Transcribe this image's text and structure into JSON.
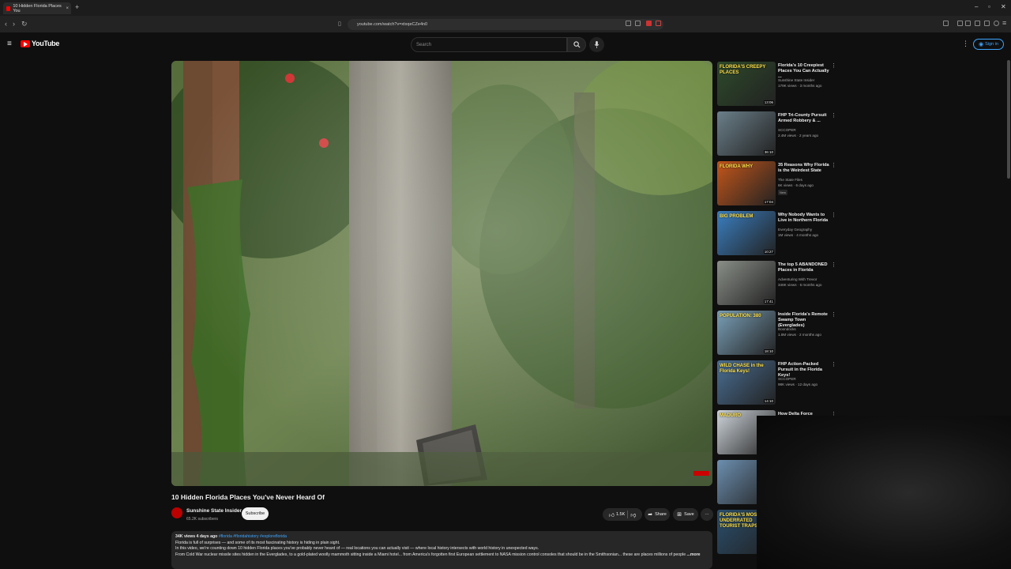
{
  "browser": {
    "tab_title": "10 Hidden Florida Places You",
    "url": "youtube.com/watch?v=xtxqeCZe4n0",
    "new_tab": "+",
    "close_tab": "×"
  },
  "header": {
    "logo_text": "YouTube",
    "search_placeholder": "Search",
    "signin_label": "Sign in"
  },
  "video": {
    "title": "10 Hidden Florida Places You've Never Heard Of",
    "channel": "Sunshine State Insider",
    "subscribers": "65.2K subscribers",
    "subscribe_label": "Subscribe",
    "likes": "1.5K",
    "share_label": "Share",
    "save_label": "Save",
    "more_label": "···"
  },
  "description": {
    "meta": "34K views  4 days ago",
    "hashtags": "#florida #floridahistory #exploreflorida",
    "line1": "Florida is full of surprises — and some of its most fascinating history is hiding in plain sight.",
    "line2": "In this video, we're counting down 10 hidden Florida places you've probably never heard of — real locations you can actually visit — where local history intersects with world history in unexpected ways.",
    "line3": "From Cold War nuclear missile sites hidden in the Everglades, to a gold-plated woolly mammoth sitting inside a Miami hotel... from America's forgotten first European settlement to NASA mission control consoles that should be in the Smithsonian... these are places millions of people",
    "more": "...more"
  },
  "recommendations": [
    {
      "title": "Florida's 10 Creepiest Places You Can Actually ...",
      "channel": "Sunshine State Insider",
      "meta": "179K views · 3 months ago",
      "duration": "13:06",
      "thumb_text": "FLORIDA'S CREEPY PLACES",
      "thumb_color": "#2d4a2a"
    },
    {
      "title": "FHP Tri-County Pursuit Armed Robbery & ...",
      "channel": "SCCOPER",
      "meta": "2.4M views · 2 years ago",
      "duration": "36:10",
      "thumb_text": "",
      "thumb_color": "#6b7f8a"
    },
    {
      "title": "35 Reasons Why Florida is the Weirdest State",
      "channel": "The State Files",
      "meta": "6K views · 6 days ago",
      "duration": "17:04",
      "badge": "New",
      "thumb_text": "FLORIDA WHY",
      "thumb_color": "#c4561a"
    },
    {
      "title": "Why Nobody Wants to Live in Northern Florida",
      "channel": "Everyday Geography",
      "meta": "1M views · 4 months ago",
      "duration": "10:27",
      "thumb_text": "BIG PROBLEM",
      "thumb_color": "#3a7fc1"
    },
    {
      "title": "The top 5 ABANDONED Places in Florida",
      "channel": "Adventuring With Trevor",
      "meta": "348K views · 6 months ago",
      "duration": "17:41",
      "thumb_text": "",
      "thumb_color": "#8a8f88"
    },
    {
      "title": "Inside Florida's Remote Swamp Town (Everglades)",
      "channel": "Boondocks",
      "meta": "1.8M views · 2 months ago",
      "duration": "18:10",
      "thumb_text": "POPULATION: 380",
      "thumb_color": "#7aa0b8"
    },
    {
      "title": "FHP Action-Packed Pursuit in the Florida Keys!",
      "channel": "SCCOPER",
      "meta": "98K views · 12 days ago",
      "duration": "14:10",
      "thumb_text": "WILD CHASE in the Florida Keys!",
      "thumb_color": "#4a6f94"
    },
    {
      "title": "How Delta Force Captured",
      "channel": "",
      "meta": "",
      "duration": "",
      "thumb_text": "MADURO",
      "thumb_color": "#cfd6dc"
    },
    {
      "title": "",
      "channel": "",
      "meta": "",
      "duration": "",
      "thumb_text": "",
      "thumb_color": "#6c8fb0"
    },
    {
      "title": "",
      "channel": "",
      "meta": "",
      "duration": "",
      "thumb_text": "FLORIDA'S MOST UNDERRATED TOURIST TRAPS",
      "thumb_color": "#2a4f6e"
    }
  ],
  "colors": {
    "accent": "#3ea6ff",
    "brand": "#ff0000",
    "background": "#0f0f0f"
  }
}
